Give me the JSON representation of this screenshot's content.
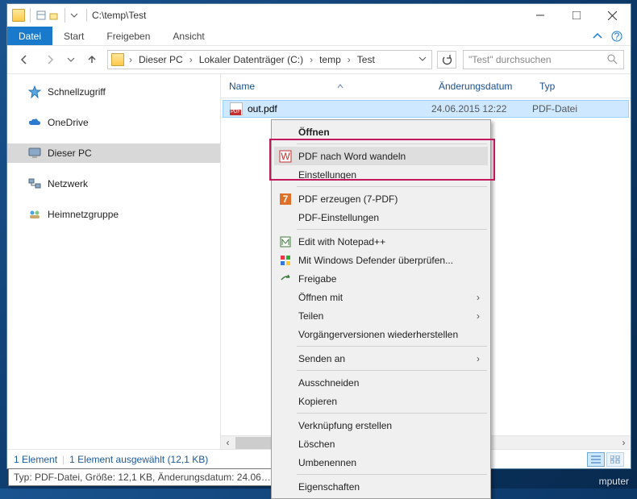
{
  "titlebar": {
    "path": "C:\\temp\\Test"
  },
  "ribbon": {
    "file": "Datei",
    "tabs": [
      "Start",
      "Freigeben",
      "Ansicht"
    ]
  },
  "breadcrumbs": [
    "Dieser PC",
    "Lokaler Datenträger (C:)",
    "temp",
    "Test"
  ],
  "search": {
    "placeholder": "\"Test\" durchsuchen"
  },
  "nav": {
    "items": [
      {
        "name": "schnellzugriff",
        "label": "Schnellzugriff",
        "icon": "star"
      },
      {
        "name": "onedrive",
        "label": "OneDrive",
        "icon": "cloud"
      },
      {
        "name": "dieser-pc",
        "label": "Dieser PC",
        "icon": "pc",
        "selected": true
      },
      {
        "name": "netzwerk",
        "label": "Netzwerk",
        "icon": "net"
      },
      {
        "name": "heimnetzgruppe",
        "label": "Heimnetzgruppe",
        "icon": "home"
      }
    ]
  },
  "columns": {
    "name": "Name",
    "date": "Änderungsdatum",
    "type": "Typ"
  },
  "file": {
    "name": "out.pdf",
    "date": "24.06.2015 12:22",
    "type": "PDF-Datei"
  },
  "status": {
    "count": "1 Element",
    "selected": "1 Element ausgewählt (12,1 KB)"
  },
  "tooltip": "Typ: PDF-Datei, Größe: 12,1 KB, Änderungsdatum: 24.06…",
  "taskbar": "mputer",
  "context_menu": {
    "items": [
      {
        "label": "Öffnen",
        "bold": true
      },
      {
        "sep": true
      },
      {
        "label": "PDF nach Word wandeln",
        "icon": "pdfword",
        "hover": true
      },
      {
        "label": "Einstellungen"
      },
      {
        "sep": true
      },
      {
        "label": "PDF erzeugen (7-PDF)",
        "icon": "7pdf"
      },
      {
        "label": "PDF-Einstellungen"
      },
      {
        "sep": true
      },
      {
        "label": "Edit with Notepad++",
        "icon": "npp"
      },
      {
        "label": "Mit Windows Defender überprüfen...",
        "icon": "defender"
      },
      {
        "label": "Freigabe",
        "icon": "share"
      },
      {
        "label": "Öffnen mit",
        "submenu": true
      },
      {
        "label": "Teilen",
        "submenu": true
      },
      {
        "label": "Vorgängerversionen wiederherstellen"
      },
      {
        "sep": true
      },
      {
        "label": "Senden an",
        "submenu": true
      },
      {
        "sep": true
      },
      {
        "label": "Ausschneiden"
      },
      {
        "label": "Kopieren"
      },
      {
        "sep": true
      },
      {
        "label": "Verknüpfung erstellen"
      },
      {
        "label": "Löschen"
      },
      {
        "label": "Umbenennen"
      },
      {
        "sep": true
      },
      {
        "label": "Eigenschaften"
      }
    ]
  }
}
